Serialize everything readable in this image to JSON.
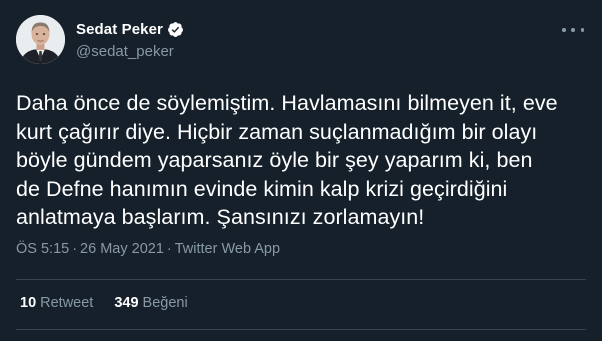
{
  "author": {
    "display_name": "Sedat Peker",
    "handle": "@sedat_peker",
    "verified": true,
    "verified_color": "#1da1f2"
  },
  "tweet": {
    "lines": [
      "Daha önce de söylemiştim. Havlamasını bilmeyen it, eve",
      "kurt çağırır diye. Hiçbir zaman suçlanmadığım bir olayı",
      "böyle gündem yaparsanız öyle bir şey yaparım ki, ben",
      "de Defne hanımın evinde kimin kalp krizi geçirdiğini",
      "anlatmaya başlarım. Şansınızı zorlamayın!"
    ]
  },
  "meta": {
    "time": "ÖS 5:15",
    "separator": "·",
    "date": "26 May 2021",
    "source": "Twitter Web App"
  },
  "stats": {
    "retweets_count": "10",
    "retweets_label": "Retweet",
    "likes_count": "349",
    "likes_label": "Beğeni"
  },
  "icons": {
    "more": "more-horizontal-icon",
    "verified": "verified-badge-icon"
  }
}
